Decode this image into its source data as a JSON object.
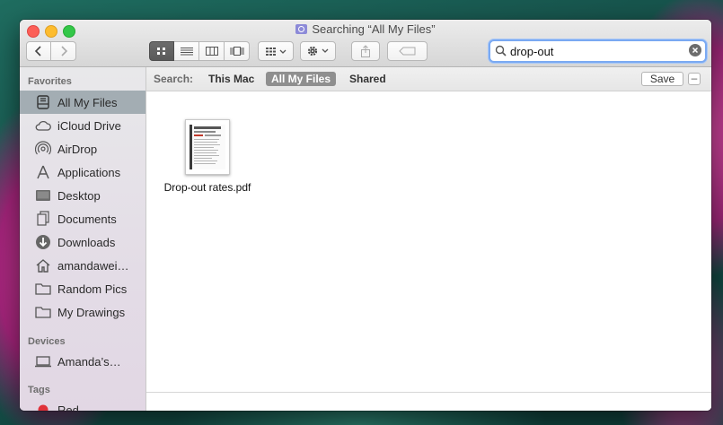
{
  "window": {
    "title": "Searching “All My Files”"
  },
  "toolbar": {
    "view_buttons": [
      "icon-view",
      "list-view",
      "column-view",
      "coverflow-view"
    ],
    "active_view": "icon-view"
  },
  "search": {
    "value": "drop-out"
  },
  "scope_bar": {
    "label": "Search:",
    "scopes": [
      "This Mac",
      "All My Files",
      "Shared"
    ],
    "selected": "All My Files",
    "save_label": "Save",
    "remove_label": "–"
  },
  "sidebar": {
    "favorites_header": "Favorites",
    "favorites": [
      {
        "label": "All My Files",
        "icon": "all-files-icon",
        "selected": true
      },
      {
        "label": "iCloud Drive",
        "icon": "cloud-icon"
      },
      {
        "label": "AirDrop",
        "icon": "airdrop-icon"
      },
      {
        "label": "Applications",
        "icon": "applications-icon"
      },
      {
        "label": "Desktop",
        "icon": "desktop-icon"
      },
      {
        "label": "Documents",
        "icon": "documents-icon"
      },
      {
        "label": "Downloads",
        "icon": "downloads-icon"
      },
      {
        "label": "amandawei…",
        "icon": "home-icon"
      },
      {
        "label": "Random Pics",
        "icon": "folder-icon"
      },
      {
        "label": "My Drawings",
        "icon": "folder-icon"
      }
    ],
    "devices_header": "Devices",
    "devices": [
      {
        "label": "Amanda’s…",
        "icon": "laptop-icon"
      }
    ],
    "tags_header": "Tags",
    "tags": [
      {
        "label": "Red",
        "color": "#e0323a"
      }
    ]
  },
  "files": [
    {
      "name": "Drop-out rates.pdf",
      "icon": "pdf-file-icon"
    }
  ]
}
